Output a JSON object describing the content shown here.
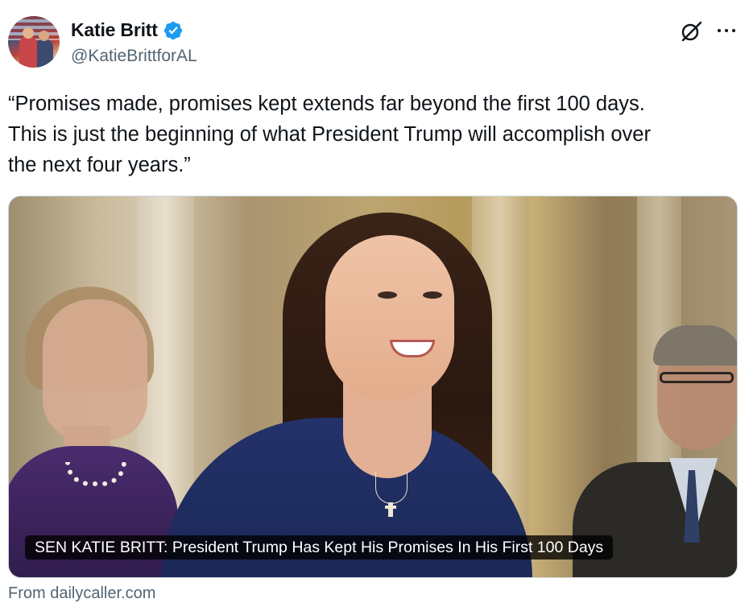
{
  "author": {
    "display_name": "Katie Britt",
    "handle": "@KatieBrittforAL",
    "verified": true
  },
  "icons": {
    "verified": "verified-badge-icon",
    "grok": "grok-icon",
    "more": "more-options-icon"
  },
  "tweet": {
    "text": "“Promises made, promises kept extends far beyond the first 100 days.\nThis is just the beginning of what President Trump will accomplish over\nthe next four years.”"
  },
  "card": {
    "caption": "SEN KATIE BRITT: President Trump Has Kept His Promises In His First 100 Days",
    "source": "From dailycaller.com"
  },
  "colors": {
    "text_primary": "#0f1419",
    "text_secondary": "#536471",
    "verified_blue": "#1d9bf0",
    "card_border": "#cfd9de"
  }
}
